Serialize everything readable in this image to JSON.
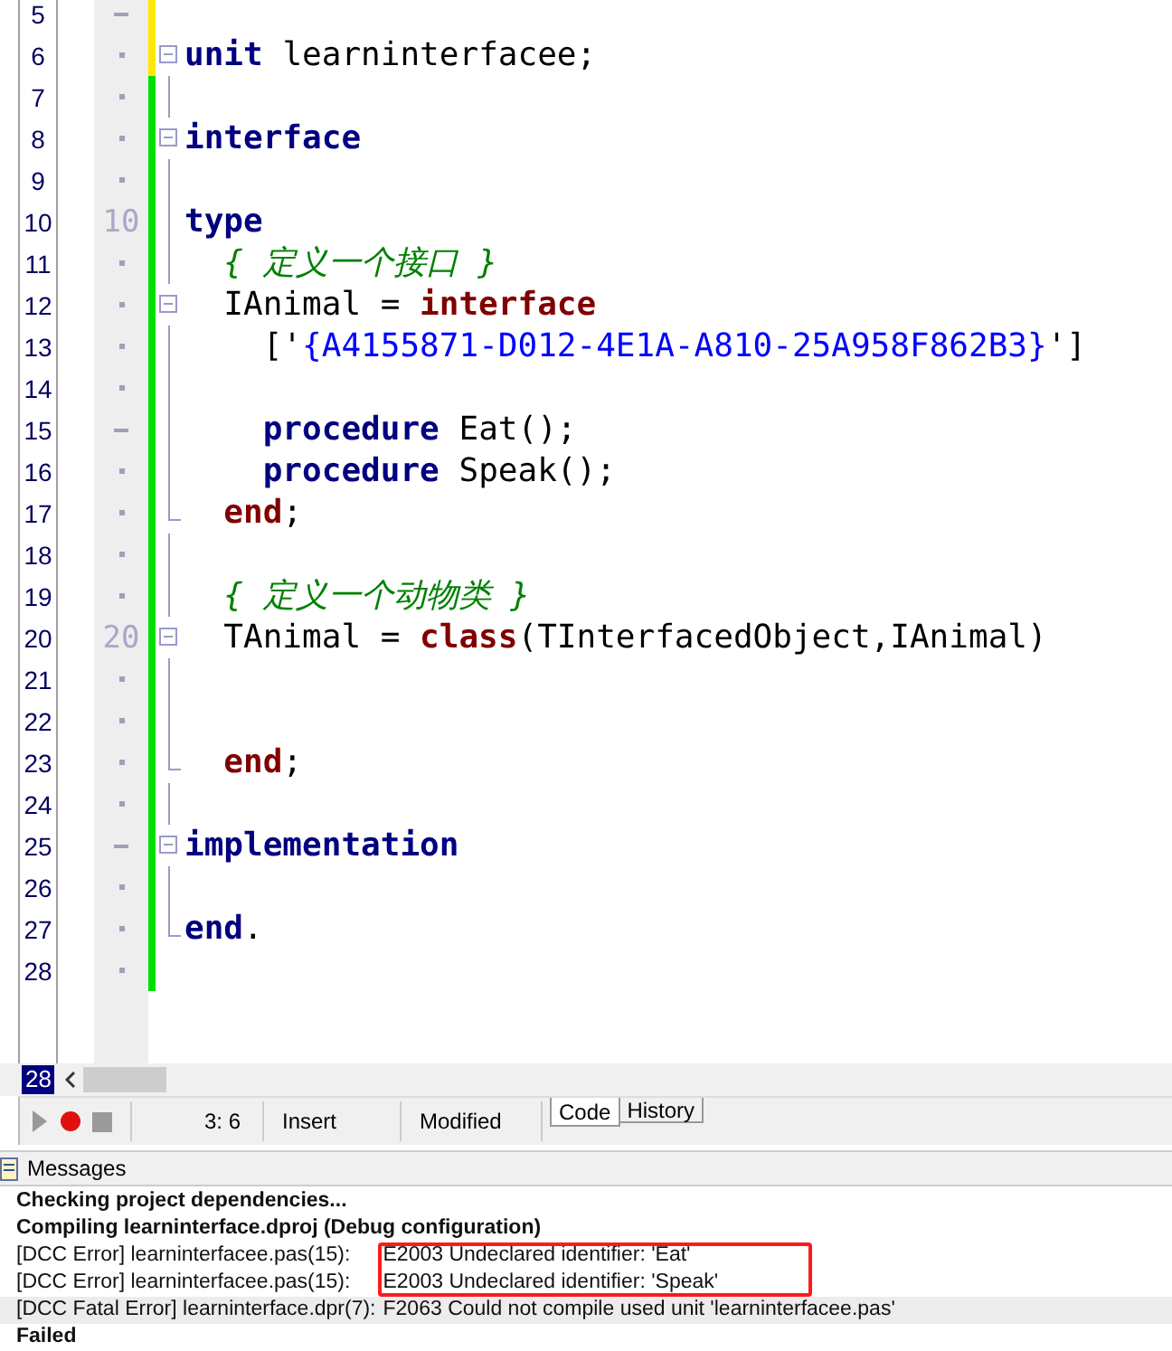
{
  "editor": {
    "lines": [
      {
        "number": "5",
        "gutter": {
          "kind": "dash"
        },
        "modified": true
      },
      {
        "number": "6",
        "gutter": {
          "kind": "dot"
        },
        "modified": true,
        "fold": {
          "kind": "start"
        },
        "tokens": [
          {
            "kind": "keyword",
            "text": "unit"
          },
          {
            "kind": "plain",
            "text": " learninterfacee;"
          }
        ]
      },
      {
        "number": "7",
        "gutter": {
          "kind": "dot"
        },
        "modified": false,
        "fold": {
          "kind": "line"
        }
      },
      {
        "number": "8",
        "gutter": {
          "kind": "dot"
        },
        "modified": false,
        "fold": {
          "kind": "start"
        },
        "tokens": [
          {
            "kind": "keyword",
            "text": "interface"
          }
        ]
      },
      {
        "number": "9",
        "gutter": {
          "kind": "dot"
        },
        "modified": false,
        "fold": {
          "kind": "line"
        }
      },
      {
        "number": "10",
        "gutter": {
          "kind": "number",
          "text": "10"
        },
        "modified": false,
        "fold": {
          "kind": "line"
        },
        "tokens": [
          {
            "kind": "keyword",
            "text": "type"
          }
        ]
      },
      {
        "number": "11",
        "gutter": {
          "kind": "dot"
        },
        "modified": false,
        "fold": {
          "kind": "line"
        },
        "tokens": [
          {
            "kind": "comment",
            "text": "  { 定义一个接口 }"
          }
        ]
      },
      {
        "number": "12",
        "gutter": {
          "kind": "dot"
        },
        "modified": false,
        "fold": {
          "kind": "start"
        },
        "tokens": [
          {
            "kind": "plain",
            "text": "  IAnimal = "
          },
          {
            "kind": "declaration",
            "text": "interface"
          }
        ]
      },
      {
        "number": "13",
        "gutter": {
          "kind": "dot"
        },
        "modified": false,
        "fold": {
          "kind": "line"
        },
        "tokens": [
          {
            "kind": "plain",
            "text": "    ['"
          },
          {
            "kind": "string",
            "text": "{A4155871-D012-4E1A-A810-25A958F862B3}"
          },
          {
            "kind": "plain",
            "text": "']"
          }
        ]
      },
      {
        "number": "14",
        "gutter": {
          "kind": "dot"
        },
        "modified": false,
        "fold": {
          "kind": "line"
        }
      },
      {
        "number": "15",
        "gutter": {
          "kind": "dash"
        },
        "modified": false,
        "fold": {
          "kind": "line"
        },
        "tokens": [
          {
            "kind": "keyword",
            "text": "    procedure"
          },
          {
            "kind": "plain",
            "text": " Eat();"
          }
        ]
      },
      {
        "number": "16",
        "gutter": {
          "kind": "dot"
        },
        "modified": false,
        "fold": {
          "kind": "line"
        },
        "tokens": [
          {
            "kind": "keyword",
            "text": "    procedure"
          },
          {
            "kind": "plain",
            "text": " Speak();"
          }
        ]
      },
      {
        "number": "17",
        "gutter": {
          "kind": "dot"
        },
        "modified": false,
        "fold": {
          "kind": "end"
        },
        "tokens": [
          {
            "kind": "declaration",
            "text": "  end"
          },
          {
            "kind": "plain",
            "text": ";"
          }
        ]
      },
      {
        "number": "18",
        "gutter": {
          "kind": "dot"
        },
        "modified": false,
        "fold": {
          "kind": "line"
        }
      },
      {
        "number": "19",
        "gutter": {
          "kind": "dot"
        },
        "modified": false,
        "fold": {
          "kind": "line"
        },
        "tokens": [
          {
            "kind": "comment",
            "text": "  { 定义一个动物类 }"
          }
        ]
      },
      {
        "number": "20",
        "gutter": {
          "kind": "number",
          "text": "20"
        },
        "modified": false,
        "fold": {
          "kind": "start"
        },
        "tokens": [
          {
            "kind": "plain",
            "text": "  TAnimal = "
          },
          {
            "kind": "declaration",
            "text": "class"
          },
          {
            "kind": "plain",
            "text": "(TInterfacedObject,IAnimal)"
          }
        ]
      },
      {
        "number": "21",
        "gutter": {
          "kind": "dot"
        },
        "modified": false,
        "fold": {
          "kind": "line"
        }
      },
      {
        "number": "22",
        "gutter": {
          "kind": "dot"
        },
        "modified": false,
        "fold": {
          "kind": "line"
        }
      },
      {
        "number": "23",
        "gutter": {
          "kind": "dot"
        },
        "modified": false,
        "fold": {
          "kind": "end"
        },
        "tokens": [
          {
            "kind": "declaration",
            "text": "  end"
          },
          {
            "kind": "plain",
            "text": ";"
          }
        ]
      },
      {
        "number": "24",
        "gutter": {
          "kind": "dot"
        },
        "modified": false,
        "fold": {
          "kind": "line"
        }
      },
      {
        "number": "25",
        "gutter": {
          "kind": "dash"
        },
        "modified": false,
        "fold": {
          "kind": "start"
        },
        "tokens": [
          {
            "kind": "keyword",
            "text": "implementation"
          }
        ]
      },
      {
        "number": "26",
        "gutter": {
          "kind": "dot"
        },
        "modified": false,
        "fold": {
          "kind": "line"
        }
      },
      {
        "number": "27",
        "gutter": {
          "kind": "dot"
        },
        "modified": false,
        "fold": {
          "kind": "end"
        },
        "tokens": [
          {
            "kind": "keyword",
            "text": "end"
          },
          {
            "kind": "plain",
            "text": "."
          }
        ]
      },
      {
        "number": "28",
        "gutter": {
          "kind": "dot"
        },
        "modified": false
      }
    ],
    "current_line": "28"
  },
  "status_bar": {
    "position": "3:  6",
    "mode": "Insert",
    "state": "Modified",
    "tabs": [
      {
        "label": "Code",
        "selected": true
      },
      {
        "label": "History",
        "selected": false
      }
    ]
  },
  "messages": {
    "title": "Messages",
    "lines": [
      {
        "kind": "bold",
        "text": "Checking project dependencies...",
        "boxed": false
      },
      {
        "kind": "bold",
        "text": "Compiling learninterface.dproj (Debug configuration)",
        "boxed": false
      },
      {
        "kind": "error",
        "source": "[DCC Error] learninterfacee.pas(15):",
        "text": "E2003 Undeclared identifier: 'Eat'",
        "boxed": true
      },
      {
        "kind": "error",
        "source": "[DCC Error] learninterfacee.pas(15):",
        "text": "E2003 Undeclared identifier: 'Speak'",
        "boxed": true
      },
      {
        "kind": "fatal",
        "source": "[DCC Fatal Error] learninterface.dpr(7):",
        "text": "F2063 Could not compile used unit 'learninterfacee.pas'",
        "boxed": false
      },
      {
        "kind": "bold",
        "text": "Failed",
        "boxed": false
      }
    ]
  }
}
